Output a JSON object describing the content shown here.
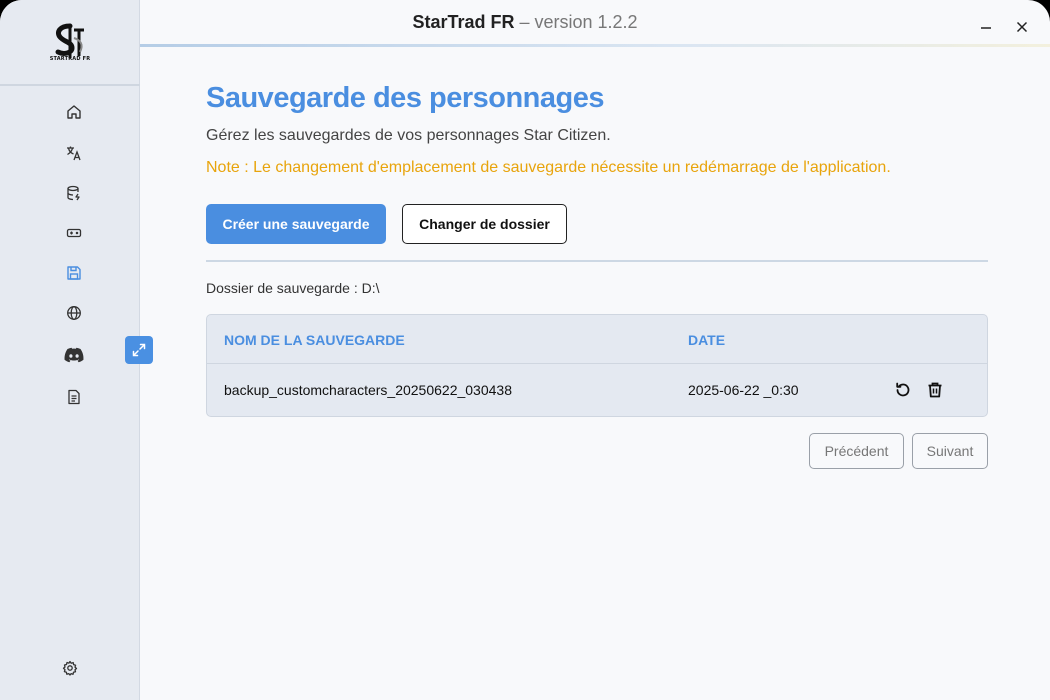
{
  "app": {
    "name": "StarTrad FR",
    "version_text": " – version 1.2.2",
    "logo_text": "STARTRAD FR"
  },
  "sidebar": {
    "items": [
      {
        "icon": "home-icon"
      },
      {
        "icon": "translate-icon"
      },
      {
        "icon": "database-icon"
      },
      {
        "icon": "gamepad-icon"
      },
      {
        "icon": "save-icon",
        "active": true
      },
      {
        "icon": "globe-icon"
      },
      {
        "icon": "discord-icon"
      },
      {
        "icon": "document-icon"
      }
    ],
    "bottom_icon": "settings-icon"
  },
  "main": {
    "title": "Sauvegarde des personnages",
    "subtitle": "Gérez les sauvegardes de vos personnages Star Citizen.",
    "note": "Note : Le changement d'emplacement de sauvegarde nécessite un redémarrage de l'application.",
    "create_button": "Créer une sauvegarde",
    "change_folder_button": "Changer de dossier",
    "folder_label": "Dossier de sauvegarde : D:\\"
  },
  "table": {
    "columns": [
      "NOM DE LA SAUVEGARDE",
      "DATE"
    ],
    "rows": [
      {
        "name": "backup_customcharacters_20250622_030438",
        "date": "2025-06-22 _0:30"
      }
    ]
  },
  "pagination": {
    "previous": "Précédent",
    "next": "Suivant"
  },
  "colors": {
    "accent": "#4a8ee0",
    "note": "#e8a40c",
    "sidebar_bg": "#e6eaf1"
  }
}
